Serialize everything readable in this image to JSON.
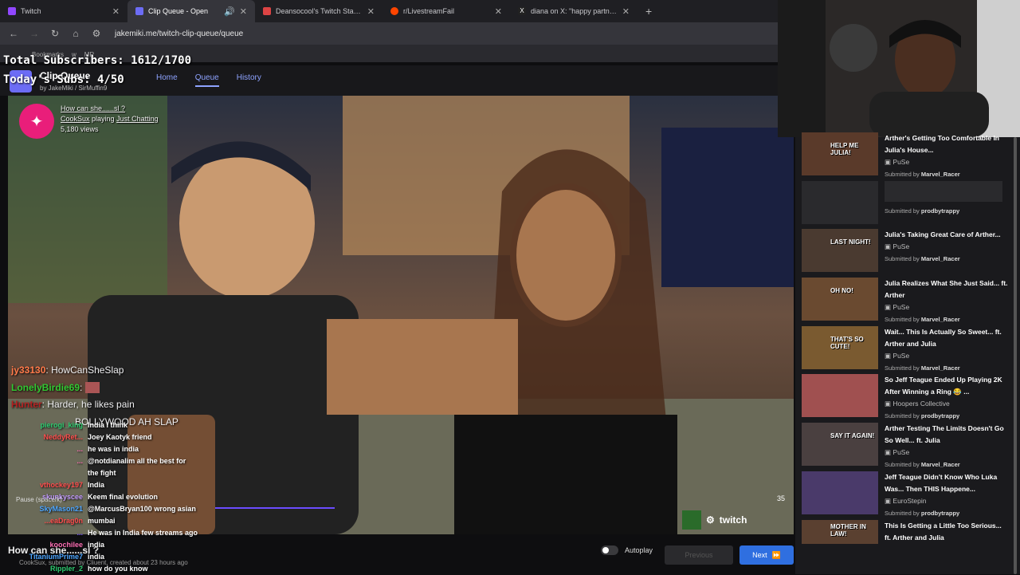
{
  "browser": {
    "tabs": [
      {
        "label": "Twitch",
        "color": "#9147ff",
        "active": false
      },
      {
        "label": "Clip Queue - Open",
        "color": "#6c6cf5",
        "active": true
      },
      {
        "label": "Deansocool's Twitch Statistics -",
        "color": "#d44",
        "active": false
      },
      {
        "label": "r/LivestreamFail",
        "color": "#ff4500",
        "active": false
      },
      {
        "label": "diana on X: \"happy partner ann",
        "color": "#222",
        "active": false
      }
    ],
    "url": "jakemiki.me/twitch-clip-queue/queue",
    "bookmarks": [
      "Bookmarks",
      "w",
      "MR"
    ]
  },
  "overlay": {
    "total_subs": "Total Subscribers: 1612/1700",
    "today_subs": "Today's Subs: 4/50"
  },
  "app": {
    "title": "Clip Queue",
    "by": "by JakeMiki / SirMuffin9",
    "nav": [
      "Home",
      "Queue",
      "History"
    ]
  },
  "clip": {
    "title": "How can she......sl ?",
    "channel": "CookSux",
    "playing_label": "playing",
    "category": "Just Chatting",
    "views": "5,180 views",
    "counter": "35",
    "bottom_title": "How can she......sl ?",
    "meta": "CookSux, submitted by Cliuent, created about 23 hours ago"
  },
  "chat_big": [
    {
      "name": "jy33130",
      "color": "#ff7a4a",
      "msg": "HowCanSheSlap"
    },
    {
      "name": "LonelyBirdie69",
      "color": "#32c832",
      "msg": ""
    },
    {
      "name": "Hunter",
      "color": "#b22222",
      "msg": "Harder, he likes pain"
    },
    {
      "name": "",
      "color": "#fff",
      "msg": "BOLLYWOOD AH SLAP"
    }
  ],
  "chat_small": [
    {
      "name": "pierogi_king",
      "color": "#2ecc71",
      "msg": "India i think"
    },
    {
      "name": "NeddyRet...",
      "color": "#ff4d4d",
      "msg": "Joey Kaotyk friend"
    },
    {
      "name": "...",
      "color": "#ff6fb5",
      "msg": "he was in india"
    },
    {
      "name": "...",
      "color": "#ff6fb5",
      "msg": "@notdianalim all the best for"
    },
    {
      "name": "",
      "color": "#fff",
      "msg": "the fight"
    },
    {
      "name": "vthockey197",
      "color": "#ff4d4d",
      "msg": "India"
    },
    {
      "name": "skunkyscee",
      "color": "#c39bff",
      "msg": "Keem final evolution"
    },
    {
      "name": "SkyMason21",
      "color": "#4da6ff",
      "msg": "@MarcusBryan100 wrong asian"
    },
    {
      "name": "...eaDrag0n",
      "color": "#ff4d4d",
      "msg": "mumbai"
    },
    {
      "name": "...",
      "color": "#7a5cff",
      "msg": "He was in India few streams ago"
    },
    {
      "name": "koochilee",
      "color": "#ff6fb5",
      "msg": "india"
    },
    {
      "name": "TitaniumPrime7",
      "color": "#4da6ff",
      "msg": "india"
    },
    {
      "name": "Rippler_2",
      "color": "#2ecc71",
      "msg": "how do you know"
    }
  ],
  "pause_hint": "Pause (space/k)",
  "controls": {
    "autoplay": "Autoplay",
    "previous": "Previous",
    "next": "Next"
  },
  "queue": [
    {
      "title": "Arther's Getting Too Comfortable In Julia's House...",
      "channel": "PuSe",
      "submitted_label": "Submitted by",
      "submitter": "Marvel_Racer",
      "thumb": "HELP ME JULIA!",
      "thumb_color": "#5a3a2a"
    },
    {
      "title": "",
      "channel": "",
      "submitted_label": "Submitted by",
      "submitter": "prodbytrappy",
      "thumb": "",
      "thumb_color": "#2a2a2d"
    },
    {
      "title": "Julia's Taking Great Care of Arther...",
      "channel": "PuSe",
      "submitted_label": "Submitted by",
      "submitter": "Marvel_Racer",
      "thumb": "LAST NIGHT!",
      "thumb_color": "#4a3a30"
    },
    {
      "title": "Julia Realizes What She Just Said... ft. Arther",
      "channel": "PuSe",
      "submitted_label": "Submitted by",
      "submitter": "Marvel_Racer",
      "thumb": "OH NO!",
      "thumb_color": "#6a4a30"
    },
    {
      "title": "Wait... This Is Actually So Sweet... ft. Arther and Julia",
      "channel": "PuSe",
      "submitted_label": "Submitted by",
      "submitter": "Marvel_Racer",
      "thumb": "THAT'S SO CUTE!",
      "thumb_color": "#7a5a30"
    },
    {
      "title": "So Jeff Teague Ended Up Playing 2K After Winning a Ring 😂 ...",
      "channel": "Hoopers Collective",
      "submitted_label": "Submitted by",
      "submitter": "prodbytrappy",
      "thumb": "",
      "thumb_color": "#a05050"
    },
    {
      "title": "Arther Testing The Limits Doesn't Go So Well... ft. Julia",
      "channel": "PuSe",
      "submitted_label": "Submitted by",
      "submitter": "Marvel_Racer",
      "thumb": "SAY IT AGAIN!",
      "thumb_color": "#4a4040"
    },
    {
      "title": "Jeff Teague Didn't Know Who Luka Was... Then THIS Happene...",
      "channel": "EuroStepin",
      "submitted_label": "Submitted by",
      "submitter": "prodbytrappy",
      "thumb": "",
      "thumb_color": "#4a3a6a"
    },
    {
      "title": "This Is Getting a Little Too Serious... ft. Arther and Julia",
      "channel": "",
      "submitted_label": "",
      "submitter": "",
      "thumb": "MOTHER IN LAW!",
      "thumb_color": "#5a4030"
    }
  ]
}
